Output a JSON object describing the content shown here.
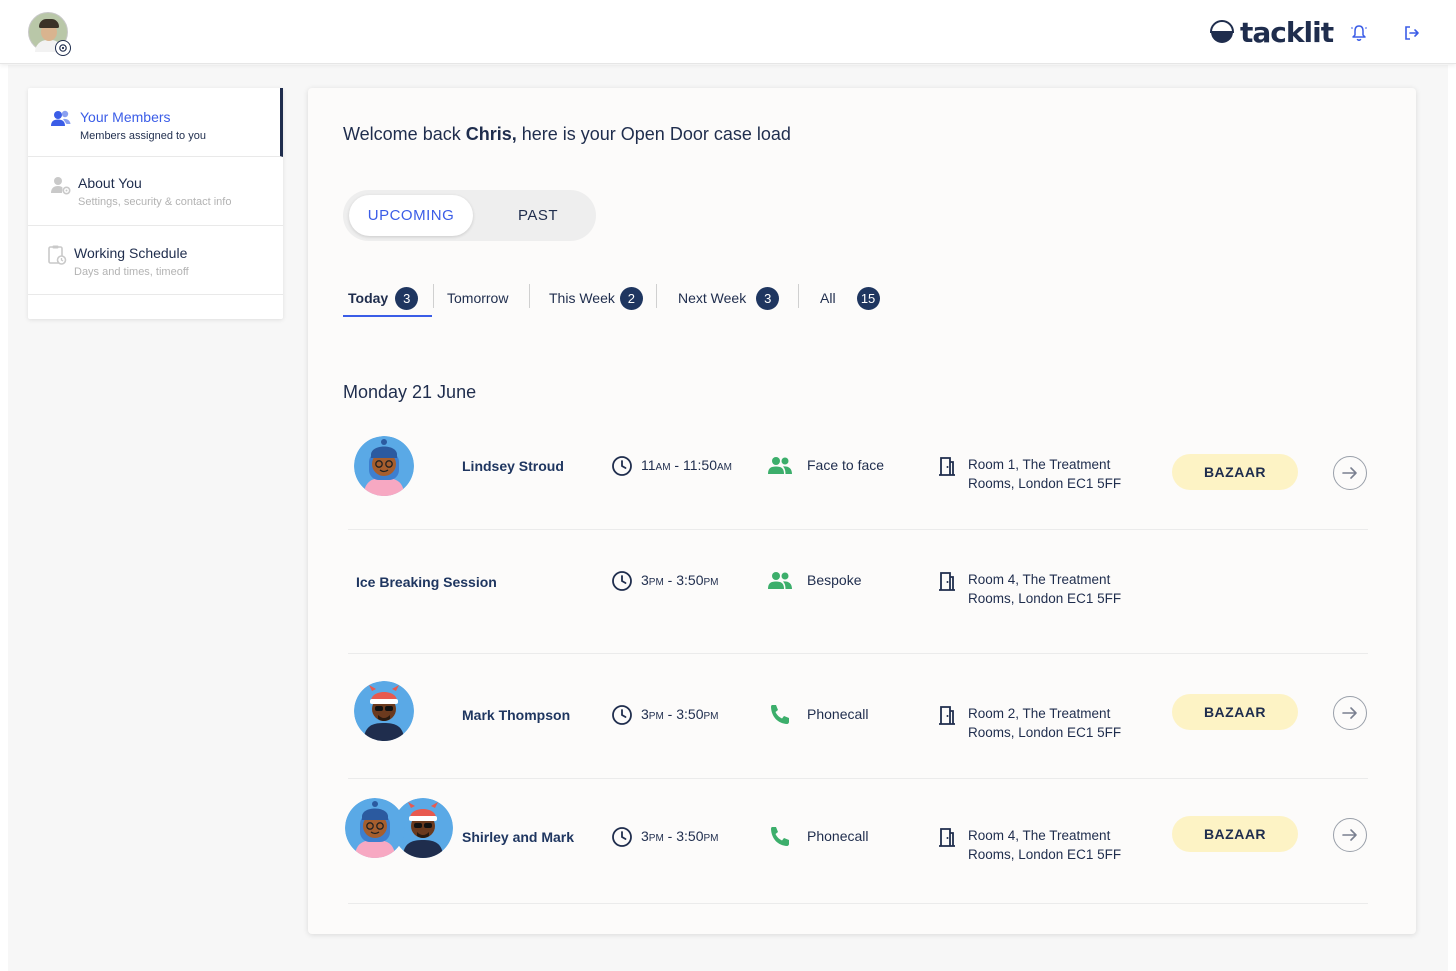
{
  "brand": {
    "name": "tacklit"
  },
  "sidebar": {
    "items": [
      {
        "title": "Your Members",
        "subtitle": "Members assigned to you"
      },
      {
        "title": "About You",
        "subtitle": "Settings, security & contact info"
      },
      {
        "title": "Working Schedule",
        "subtitle": "Days and times, timeoff"
      }
    ]
  },
  "main": {
    "welcome_prefix": "Welcome back ",
    "welcome_name": "Chris,",
    "welcome_suffix": " here is your Open Door case load",
    "toggle": {
      "upcoming": "UPCOMING",
      "past": "PAST"
    },
    "tabs": [
      {
        "label": "Today",
        "count": "3"
      },
      {
        "label": "Tomorrow",
        "count": ""
      },
      {
        "label": "This Week",
        "count": "2"
      },
      {
        "label": "Next Week",
        "count": "3"
      },
      {
        "label": "All",
        "count": "15"
      }
    ],
    "date_heading": "Monday 21 June",
    "appointments": [
      {
        "name": "Lindsey Stroud",
        "time_start": "11",
        "time_start_ampm": "AM",
        "time_sep": " - ",
        "time_end": "11:50",
        "time_end_ampm": "AM",
        "mode": "Face to face",
        "room_line1": "Room 1, The Treatment",
        "room_line2": "Rooms, London EC1 5FF",
        "tag": "BAZAAR"
      },
      {
        "name": "Ice Breaking Session",
        "time_start": "3",
        "time_start_ampm": "PM",
        "time_sep": " - ",
        "time_end": "3:50",
        "time_end_ampm": "PM",
        "mode": "Bespoke",
        "room_line1": "Room 4, The Treatment",
        "room_line2": "Rooms, London EC1 5FF",
        "tag": ""
      },
      {
        "name": "Mark Thompson",
        "time_start": "3",
        "time_start_ampm": "PM",
        "time_sep": " - ",
        "time_end": "3:50",
        "time_end_ampm": "PM",
        "mode": "Phonecall",
        "room_line1": "Room 2, The Treatment",
        "room_line2": "Rooms, London EC1 5FF",
        "tag": "BAZAAR"
      },
      {
        "name": "Shirley and Mark",
        "time_start": "3",
        "time_start_ampm": "PM",
        "time_sep": " - ",
        "time_end": "3:50",
        "time_end_ampm": "PM",
        "mode": "Phonecall",
        "room_line1": "Room 4, The Treatment",
        "room_line2": "Rooms, London EC1 5FF",
        "tag": "BAZAAR"
      }
    ]
  },
  "icons": {
    "topbar": [
      "settings-icon",
      "bell-icon",
      "logout-icon"
    ],
    "sidebar": [
      "members-icon",
      "user-settings-icon",
      "clipboard-clock-icon"
    ],
    "row": [
      "clock-icon",
      "group-icon",
      "phone-icon",
      "door-icon",
      "arrow-right-icon"
    ]
  },
  "colors": {
    "accent": "#3b5de7",
    "navy": "#1f3660",
    "tag_bg": "#fdf3c5",
    "green": "#3cae6b"
  }
}
